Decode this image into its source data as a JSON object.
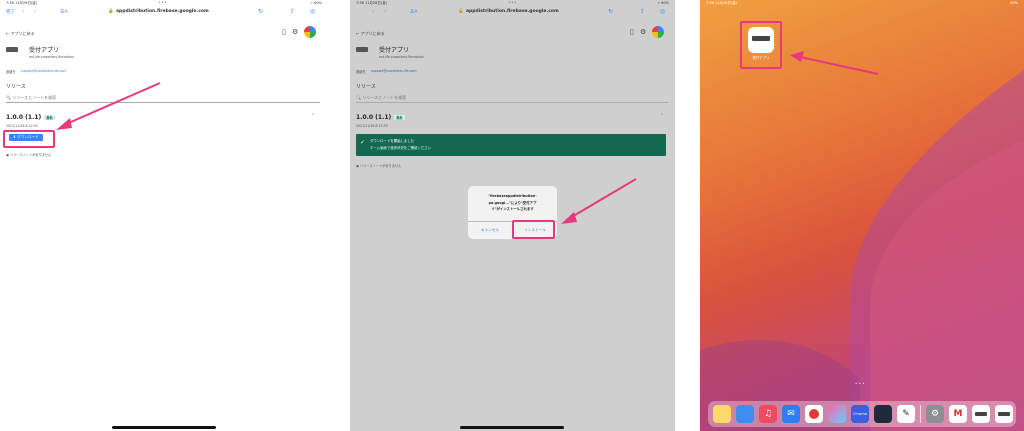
{
  "panel1": {
    "status_time": "7:36 11月26日(金)",
    "status_right": "⚡ 60%",
    "toolbar_left": "完了",
    "toolbar_aa": "あA",
    "url": "appdistribution.firebase.google.com",
    "back_label": "← アプリに戻る",
    "app_name": "受付アプリ",
    "bundle_id": "ext.life.coworkers.Reception",
    "contact_label": "連絡先",
    "contact_email": "support@coworkers-life.com",
    "release_section": "リリース",
    "search_placeholder": "リリースとノートを検索",
    "version": "1.0.0 (1.1)",
    "version_badge": "最新",
    "release_date": "2021/11/26 8:12:53",
    "download_label": "ダウンロード",
    "no_notes": "リリースノートがありません"
  },
  "panel2": {
    "status_time": "7:36 11月26日(金)",
    "status_right": "⚡ 60%",
    "toolbar_aa": "あA",
    "url": "appdistribution.firebase.google.com",
    "back_label": "← アプリに戻る",
    "app_name": "受付アプリ",
    "bundle_id": "ext.life.coworkers.Reception",
    "contact_label": "連絡先",
    "contact_email": "support@coworkers-life.com",
    "release_section": "リリース",
    "search_placeholder": "リリースとノートを検索",
    "version": "1.0.0 (1.1)",
    "version_badge": "最新",
    "release_date": "2021/11/26 8:12:53",
    "toast_title": "ダウンロードを開始しました",
    "toast_sub": "ホーム画面で進捗状況をご確認ください",
    "no_notes": "リリースノートがありません",
    "dialog_line1": "\"firebaseappdistribution-",
    "dialog_line2": "pa.googl...\"により\"受付アプ",
    "dialog_line3": "リ\"がインストールされます",
    "dialog_cancel": "キャンセル",
    "dialog_install": "インストール"
  },
  "panel3": {
    "status_time": "7:36 11月26日(金)",
    "status_right": "60%",
    "app_icon_label": "受付アプリ",
    "page_dots": "• • •",
    "dock_icon_label": "Chrome"
  },
  "colors": {
    "accent_pink": "#e8387f",
    "link_blue": "#3b82f6",
    "toast_green": "#13684f"
  }
}
